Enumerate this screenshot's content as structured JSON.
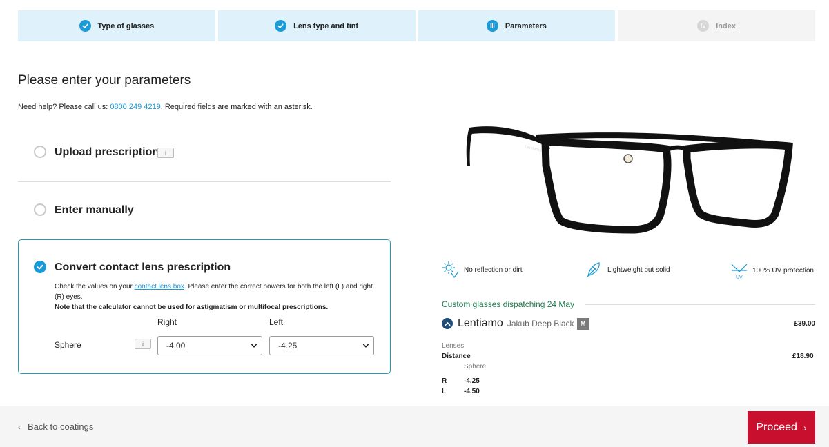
{
  "steps": [
    {
      "label": "Type of glasses",
      "state": "done"
    },
    {
      "label": "Lens type and tint",
      "state": "done"
    },
    {
      "label": "Parameters",
      "state": "active",
      "numeral": "III"
    },
    {
      "label": "Index",
      "state": "upcoming",
      "numeral": "IV"
    }
  ],
  "page": {
    "title": "Please enter your parameters",
    "help_prefix": "Need help? Please call us: ",
    "help_phone": "0800 249 4219",
    "help_suffix": ". Required fields are marked with an asterisk."
  },
  "options": {
    "upload": {
      "label": "Upload prescription",
      "info": "i",
      "selected": false
    },
    "manual": {
      "label": "Enter manually",
      "selected": false
    },
    "convert": {
      "label": "Convert contact lens prescription",
      "selected": true,
      "desc_prefix": "Check the values on your ",
      "desc_link": "contact lens box",
      "desc_suffix": ". Please enter the correct powers for both the left (L) and right (R) eyes.",
      "note": "Note that the calculator cannot be used for astigmatism or multifocal prescriptions.",
      "col_right": "Right",
      "col_left": "Left",
      "row_label": "Sphere",
      "row_info": "i",
      "right_value": "-4.00",
      "left_value": "-4.25"
    }
  },
  "features": [
    {
      "icon": "sun-reflection-icon",
      "label": "No reflection or dirt"
    },
    {
      "icon": "feather-icon",
      "label": "Lightweight but solid"
    },
    {
      "icon": "uv-protection-icon",
      "label": "100% UV protection",
      "icon_text": "UV"
    }
  ],
  "summary": {
    "dispatch": "Custom glasses dispatching 24 May",
    "brand": "Lentiamo",
    "model": "Jakub Deep Black",
    "size": "M",
    "frame_price": "£39.00",
    "lenses_label": "Lenses",
    "distance_label": "Distance",
    "distance_price": "£18.90",
    "sphere_label": "Sphere",
    "r_label": "R",
    "r_value": "-4.25",
    "l_label": "L",
    "l_value": "-4.50"
  },
  "footer": {
    "back_label": "Back to coatings",
    "proceed_label": "Proceed"
  },
  "colors": {
    "accent": "#1a9ad6",
    "step_bg": "#dff2fb",
    "card_border": "#1e9fb5",
    "dispatch": "#1c7a4d",
    "proceed": "#c8102e"
  }
}
